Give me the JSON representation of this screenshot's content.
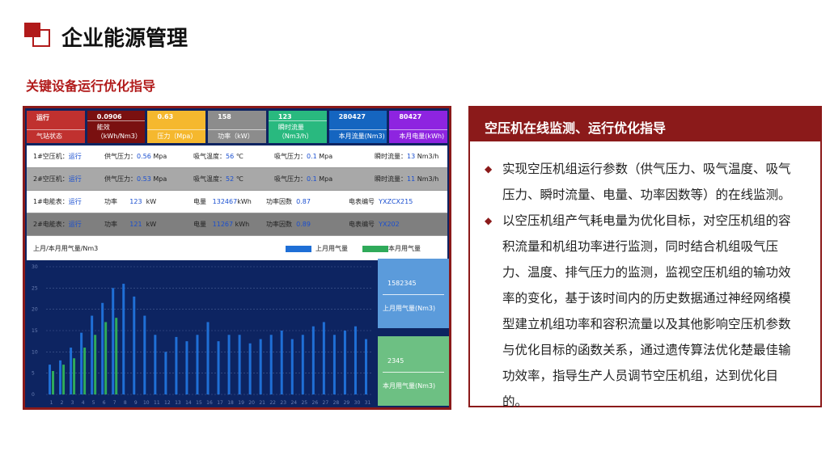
{
  "page": {
    "title": "企业能源管理",
    "section_title": "关键设备运行优化指导"
  },
  "colors": {
    "brand": "#8b1a1a",
    "upper_month": "#1f6fd6",
    "this_month": "#2faa5a",
    "dashboard_bg": "#0d2461"
  },
  "kpis": [
    {
      "value": "运行",
      "label": "气站状态",
      "color": "#c0312f"
    },
    {
      "value": "0.0906",
      "label": "能效（kWh/Nm3）",
      "color": "#7a1010"
    },
    {
      "value": "0.63",
      "label": "压力（Mpa）",
      "color": "#f5b82e"
    },
    {
      "value": "158",
      "label": "功率（kW）",
      "color": "#8c8c8c"
    },
    {
      "value": "123",
      "label": "瞬时流量（Nm3/h）",
      "color": "#29b97f"
    },
    {
      "value": "280427",
      "label": "本月流量(Nm3)",
      "color": "#1565c0"
    },
    {
      "value": "80427",
      "label": "本月电量(kWh)",
      "color": "#8e24e0"
    }
  ],
  "rows": [
    {
      "name_label": "1#空压机：",
      "name_value": "运行",
      "c1_label": "供气压力：",
      "c1_value": "0.56",
      "c1_unit": "Mpa",
      "c2_label": "吸气温度：",
      "c2_value": "56",
      "c2_unit": "℃",
      "c3_label": "吸气压力：",
      "c3_value": "0.1",
      "c3_unit": "Mpa",
      "c4_label": "瞬时流量：",
      "c4_value": "13",
      "c4_unit": "Nm3/h"
    },
    {
      "name_label": "2#空压机：",
      "name_value": "运行",
      "c1_label": "供气压力：",
      "c1_value": "0.53",
      "c1_unit": "Mpa",
      "c2_label": "吸气温度：",
      "c2_value": "52",
      "c2_unit": "℃",
      "c3_label": "吸气压力：",
      "c3_value": "0.1",
      "c3_unit": "Mpa",
      "c4_label": "瞬时流量：",
      "c4_value": "11",
      "c4_unit": "Nm3/h"
    }
  ],
  "meters": [
    {
      "name_label": "1#电能表：",
      "name_value": "运行",
      "p_label": "功率",
      "p_value": "123",
      "p_unit": "kW",
      "e_label": "电量",
      "e_value": "132467",
      "e_unit": "kWh",
      "pf_label": "功率因数",
      "pf_value": "0.87",
      "id_label": "电表编号",
      "id_value": "YXZCX215"
    },
    {
      "name_label": "2#电能表：",
      "name_value": "运行",
      "p_label": "功率",
      "p_value": "121",
      "p_unit": "kW",
      "e_label": "电量",
      "e_value": "11267",
      "e_unit": "kWh",
      "pf_label": "功率因数",
      "pf_value": "0.89",
      "id_label": "电表编号",
      "id_value": "YX202"
    }
  ],
  "legend": {
    "title": "上月/本月用气量/Nm3",
    "upper": "上月用气量",
    "this": "本月用气量"
  },
  "cards": [
    {
      "value": "1582345",
      "label": "上月用气量(Nm3)"
    },
    {
      "value": "2345",
      "label": "本月用气量(Nm3)"
    }
  ],
  "chart_data": {
    "type": "bar",
    "title": "上月/本月用气量/Nm3",
    "ylim": [
      0,
      30
    ],
    "yticks": [
      0,
      5,
      10,
      15,
      20,
      25,
      30
    ],
    "categories": [
      "1",
      "2",
      "3",
      "4",
      "5",
      "6",
      "7",
      "8",
      "9",
      "10",
      "11",
      "12",
      "13",
      "14",
      "15",
      "16",
      "17",
      "18",
      "19",
      "20",
      "21",
      "22",
      "23",
      "24",
      "25",
      "26",
      "27",
      "28",
      "29",
      "30",
      "31"
    ],
    "series": [
      {
        "name": "上月用气量",
        "values": [
          7,
          8,
          11,
          14.5,
          18.5,
          21.5,
          25,
          26,
          23,
          18.5,
          14,
          10,
          13.5,
          12.5,
          14,
          17,
          12.5,
          14,
          14,
          12,
          13,
          14,
          15,
          13,
          14,
          16,
          17,
          14,
          15,
          16,
          13
        ]
      },
      {
        "name": "本月用气量",
        "values": [
          5.5,
          7,
          8.5,
          11,
          14,
          17,
          18
        ]
      }
    ],
    "grid": true
  },
  "right_panel": {
    "title": "空压机在线监测、运行优化指导",
    "bullets": [
      "实现空压机组运行参数（供气压力、吸气温度、吸气压力、瞬时流量、电量、功率因数等）的在线监测。",
      "以空压机组产气耗电量为优化目标，对空压机组的容积流量和机组功率进行监测，同时结合机组吸气压力、温度、排气压力的监测，监视空压机组的输功效率的变化，基于该时间内的历史数据通过神经网络模型建立机组功率和容积流量以及其他影响空压机参数与优化目标的函数关系，通过遗传算法优化楚最佳输功效率，指导生产人员调节空压机组，达到优化目的。"
    ]
  }
}
